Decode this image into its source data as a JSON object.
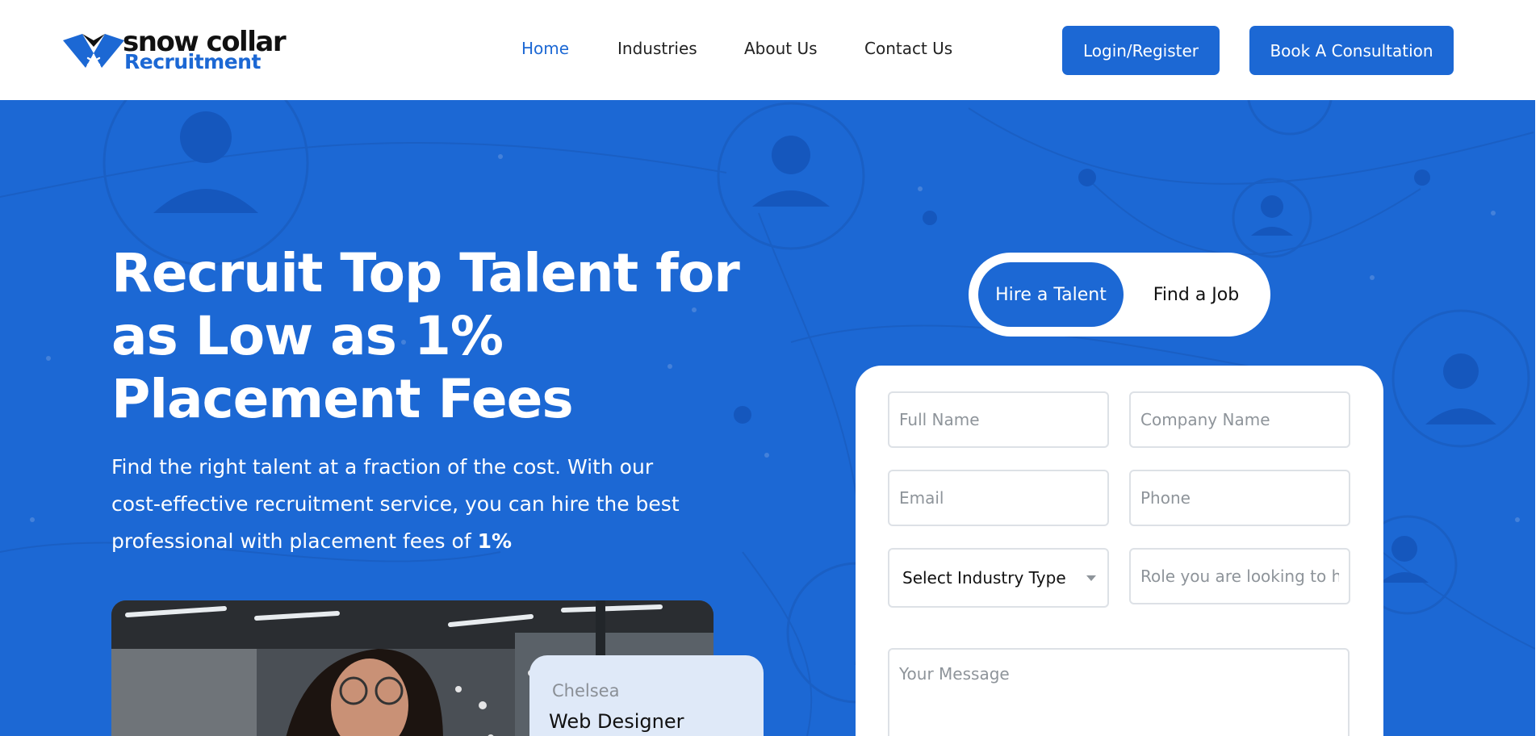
{
  "brand": {
    "name_top": "snow collar",
    "name_bottom": "Recruitment",
    "accent_color": "#1c68d4",
    "logo_icon": "snowflake-collar-icon"
  },
  "nav": {
    "items": [
      {
        "label": "Home",
        "active": true
      },
      {
        "label": "Industries",
        "active": false
      },
      {
        "label": "About Us",
        "active": false
      },
      {
        "label": "Contact Us",
        "active": false
      }
    ]
  },
  "header_buttons": {
    "login": "Login/Register",
    "consult": "Book A Consultation"
  },
  "hero": {
    "headline_lines": [
      "Recruit Top Talent for",
      "as Low as 1%",
      "Placement Fees"
    ],
    "sub_lines": [
      "Find the right talent at a fraction of the cost. With our",
      "cost-effective recruitment service, you can hire the best",
      "professional with placement fees of "
    ],
    "sub_bold": "1%",
    "person_name": "Chelsea",
    "person_role": "Web Designer"
  },
  "toggle": {
    "hire": "Hire a Talent",
    "find": "Find a Job",
    "selected": "Hire a Talent"
  },
  "form": {
    "full_name_placeholder": "Full Name",
    "company_placeholder": "Company Name",
    "email_placeholder": "Email",
    "phone_placeholder": "Phone",
    "industry_select": "Select Industry Type",
    "role_placeholder": "Role you are looking to h",
    "message_placeholder": "Your Message"
  }
}
